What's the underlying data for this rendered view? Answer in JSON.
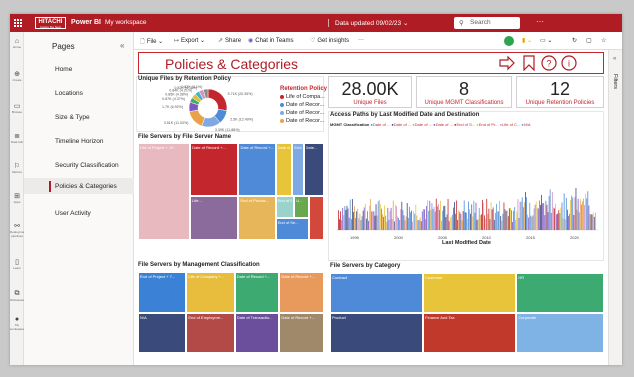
{
  "topbar": {
    "logo": "HITACHI",
    "logo_tagline": "Inspire the Next",
    "product": "Power BI",
    "workspace": "My workspace",
    "data_updated": "Data updated 09/02/23",
    "search_placeholder": "Search",
    "more": "···"
  },
  "leftrail": [
    {
      "icon": "home-icon",
      "label": "Home"
    },
    {
      "icon": "create-icon",
      "label": "Create"
    },
    {
      "icon": "browse-icon",
      "label": "Browse"
    },
    {
      "icon": "datahub-icon",
      "label": "Data hub"
    },
    {
      "icon": "metrics-icon",
      "label": "Metrics"
    },
    {
      "icon": "apps-icon",
      "label": "Apps"
    },
    {
      "icon": "deployment-icon",
      "label": "Deployment pipelines"
    },
    {
      "icon": "learn-icon",
      "label": "Learn"
    },
    {
      "icon": "workspaces-icon",
      "label": "Workspaces"
    },
    {
      "icon": "myworkspace-icon",
      "label": "My workspace"
    }
  ],
  "pages": {
    "title": "Pages",
    "items": [
      "Home",
      "Locations",
      "Size & Type",
      "Timeline Horizon",
      "Security Classification",
      "Policies & Categories",
      "User Activity"
    ],
    "active_index": 5
  },
  "toolbar": {
    "file": "File",
    "export": "Export",
    "share": "Share",
    "chat": "Chat in Teams",
    "insights": "Get insights",
    "more": "···"
  },
  "filters_label": "Filters",
  "report": {
    "title": "Policies & Categories",
    "kpis": [
      {
        "value": "28.00K",
        "label": "Unique Files"
      },
      {
        "value": "8",
        "label": "Unique MGMT Classifications"
      },
      {
        "value": "12",
        "label": "Unique Retention Policies"
      }
    ]
  },
  "colors": {
    "brand": "#b01c24",
    "accent": "#c4262e"
  },
  "chart_data": [
    {
      "type": "pie",
      "title": "Unique Files by Retention Policy",
      "legend_title": "Retention Policy",
      "legend": [
        "Life of Compa...",
        "Date of Recor...",
        "Date of Recor...",
        "Date of Recor..."
      ],
      "legend_colors": [
        "#c4262e",
        "#4e8ad8",
        "#7fa9e3",
        "#e8a34a"
      ],
      "slices": [
        {
          "label": "5.71K (20.35%)",
          "value": 5.71,
          "color": "#c4262e"
        },
        {
          "label": "2.5K (12.49%)",
          "value": 2.5,
          "color": "#4e8ad8"
        },
        {
          "label": "3.39K (11.88%)",
          "value": 3.39,
          "color": "#7fa9e3"
        },
        {
          "label": "3.51K (11.03%)",
          "value": 3.51,
          "color": "#e8a34a"
        },
        {
          "label": "1.7K (6.92%)",
          "value": 1.7,
          "color": "#7e57c2"
        },
        {
          "label": "0.87K (4.37%)",
          "value": 0.87,
          "color": "#3fae6a"
        },
        {
          "label": "0.85K (4.38%)",
          "value": 0.85,
          "color": "#e8ba3c"
        },
        {
          "label": "0.84K (4.21%)",
          "value": 0.84,
          "color": "#43b5c7"
        },
        {
          "label": "0.82K (4.11%)",
          "value": 0.82,
          "color": "#d88fc1"
        },
        {
          "label": "0.82K (3.1%)",
          "value": 0.82,
          "color": "#8a8a8a"
        }
      ]
    },
    {
      "type": "heatmap",
      "title": "File Servers by File Server Name",
      "tiles": [
        {
          "label": "Life of Project + 10...",
          "color": "#e8b9bf"
        },
        {
          "label": "Date of Record +...",
          "color": "#c4262e"
        },
        {
          "label": "Date of Record +...",
          "color": "#4e8ad8"
        },
        {
          "label": "Date of Record...",
          "color": "#e8c43a"
        },
        {
          "label": "End...",
          "color": "#7fa9e3"
        },
        {
          "label": "Date...",
          "color": "#3a4a7a"
        },
        {
          "label": "Life...",
          "color": "#8b6a9c"
        },
        {
          "label": "End of Produc...",
          "color": "#e8b65a"
        },
        {
          "label": "End of S...",
          "color": "#9ad3c9"
        },
        {
          "label": "U...",
          "color": "#6aa84f"
        },
        {
          "label": "End of Se...",
          "color": "#4e8ad8"
        },
        {
          "label": "",
          "color": "#d2493c"
        }
      ]
    },
    {
      "type": "heatmap",
      "title": "File Servers by Management Classification",
      "tiles": [
        {
          "label": "End of Project + 7...",
          "color": "#3b82d6"
        },
        {
          "label": "Life of Company +...",
          "color": "#e8bd3d"
        },
        {
          "label": "Date of Record +...",
          "color": "#3daa72"
        },
        {
          "label": "Date of Record +...",
          "color": "#e89a5c"
        },
        {
          "label": "N/A",
          "color": "#3a4a7a"
        },
        {
          "label": "End of Employme...",
          "color": "#b34a47"
        },
        {
          "label": "Date of Transactio...",
          "color": "#6b4f9c"
        },
        {
          "label": "Date of Record +...",
          "color": "#a0886a"
        }
      ]
    },
    {
      "type": "heatmap",
      "title": "File Servers by Category",
      "tiles": [
        {
          "label": "Contract",
          "color": "#4e8ad8"
        },
        {
          "label": "Customer",
          "color": "#e8c43a"
        },
        {
          "label": "HR",
          "color": "#3daa72"
        },
        {
          "label": "Product",
          "color": "#3a4a7a"
        },
        {
          "label": "Finance And Tax",
          "color": "#c0392b"
        },
        {
          "label": "Corporate",
          "color": "#7fb3e6"
        }
      ]
    },
    {
      "type": "bar",
      "title": "Access Paths by Last Modified Date and Destination",
      "legend_title": "MGMT Classification",
      "legend": [
        "Date of ...",
        "Date of ...",
        "Date of ...",
        "Date of ...",
        "End of S...",
        "End of Pr...",
        "Life of C...",
        "N/A"
      ],
      "legend_colors": [
        "#4e8ad8",
        "#3a4a7a",
        "#e8a34a",
        "#7e57c2",
        "#c4262e",
        "#e8c43a",
        "#d88fc1",
        "#5b9bd5"
      ],
      "xlabel": "Last Modified Date",
      "x_ticks": [
        "1995",
        "2000",
        "2005",
        "2010",
        "2015",
        "2020"
      ]
    }
  ]
}
